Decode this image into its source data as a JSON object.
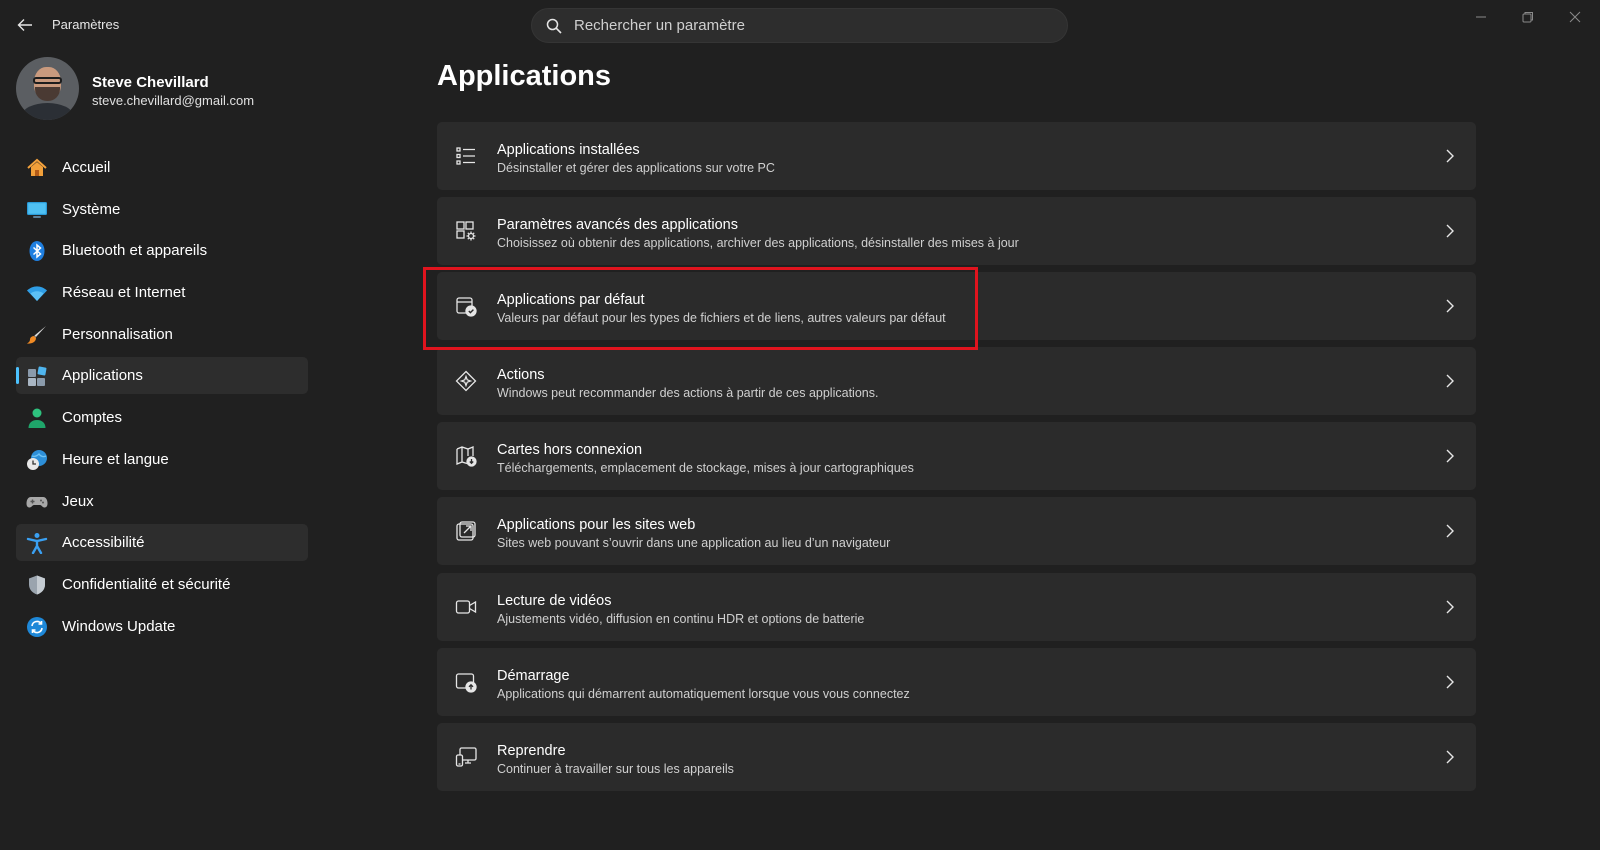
{
  "app": {
    "title": "Paramètres"
  },
  "search": {
    "placeholder": "Rechercher un paramètre"
  },
  "user": {
    "name": "Steve Chevillard",
    "email": "steve.chevillard@gmail.com"
  },
  "nav": {
    "items": [
      {
        "label": "Accueil",
        "icon": "home-icon"
      },
      {
        "label": "Système",
        "icon": "display-icon"
      },
      {
        "label": "Bluetooth et appareils",
        "icon": "bluetooth-icon"
      },
      {
        "label": "Réseau et Internet",
        "icon": "wifi-icon"
      },
      {
        "label": "Personnalisation",
        "icon": "brush-icon"
      },
      {
        "label": "Applications",
        "icon": "apps-icon",
        "active": true
      },
      {
        "label": "Comptes",
        "icon": "person-icon"
      },
      {
        "label": "Heure et langue",
        "icon": "clock-globe-icon"
      },
      {
        "label": "Jeux",
        "icon": "gamepad-icon"
      },
      {
        "label": "Accessibilité",
        "icon": "accessibility-icon"
      },
      {
        "label": "Confidentialité et sécurité",
        "icon": "shield-icon"
      },
      {
        "label": "Windows Update",
        "icon": "update-icon"
      }
    ]
  },
  "main": {
    "title": "Applications",
    "cards": [
      {
        "title": "Applications installées",
        "subtitle": "Désinstaller et gérer des applications sur votre PC",
        "icon": "list-icon"
      },
      {
        "title": "Paramètres avancés des applications",
        "subtitle": "Choisissez où obtenir des applications, archiver des applications, désinstaller des mises à jour",
        "icon": "apps-gear-icon"
      },
      {
        "title": "Applications par défaut",
        "subtitle": "Valeurs par défaut pour les types de fichiers et de liens, autres valeurs par défaut",
        "icon": "default-apps-icon",
        "highlighted": true
      },
      {
        "title": "Actions",
        "subtitle": "Windows peut recommander des actions à partir de ces applications.",
        "icon": "actions-icon"
      },
      {
        "title": "Cartes hors connexion",
        "subtitle": "Téléchargements, emplacement de stockage, mises à jour cartographiques",
        "icon": "offline-map-icon"
      },
      {
        "title": "Applications pour les sites web",
        "subtitle": "Sites web pouvant s’ouvrir dans une application au lieu d’un navigateur",
        "icon": "open-external-icon"
      },
      {
        "title": "Lecture de vidéos",
        "subtitle": "Ajustements vidéo, diffusion en continu HDR et options de batterie",
        "icon": "video-icon"
      },
      {
        "title": "Démarrage",
        "subtitle": "Applications qui démarrent automatiquement lorsque vous vous connectez",
        "icon": "startup-icon"
      },
      {
        "title": "Reprendre",
        "subtitle": "Continuer à travailler sur tous les appareils",
        "icon": "resume-devices-icon"
      }
    ]
  },
  "colors": {
    "background": "#202020",
    "card": "#2b2b2b",
    "accent": "#4cc2ff",
    "highlight": "#e0141e"
  }
}
